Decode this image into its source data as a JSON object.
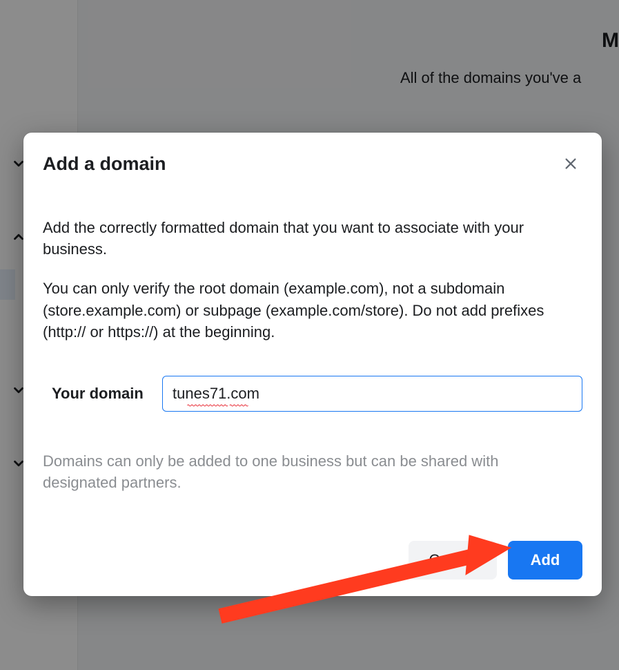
{
  "background": {
    "heading_partial": "M",
    "sub_partial": "All of the domains you've a"
  },
  "modal": {
    "title": "Add a domain",
    "paragraph1": "Add the correctly formatted domain that you want to associate with your business.",
    "paragraph2": "You can only verify the root domain (example.com), not a subdomain (store.example.com) or subpage (example.com/store). Do not add prefixes (http:// or https://) at the beginning.",
    "field_label": "Your domain",
    "domain_value": "tunes71.com",
    "help_text": "Domains can only be added to one business but can be shared with designated partners.",
    "cancel_label": "Cancel",
    "add_label": "Add"
  },
  "annotation": {
    "arrow_color": "#ff3b1f"
  }
}
